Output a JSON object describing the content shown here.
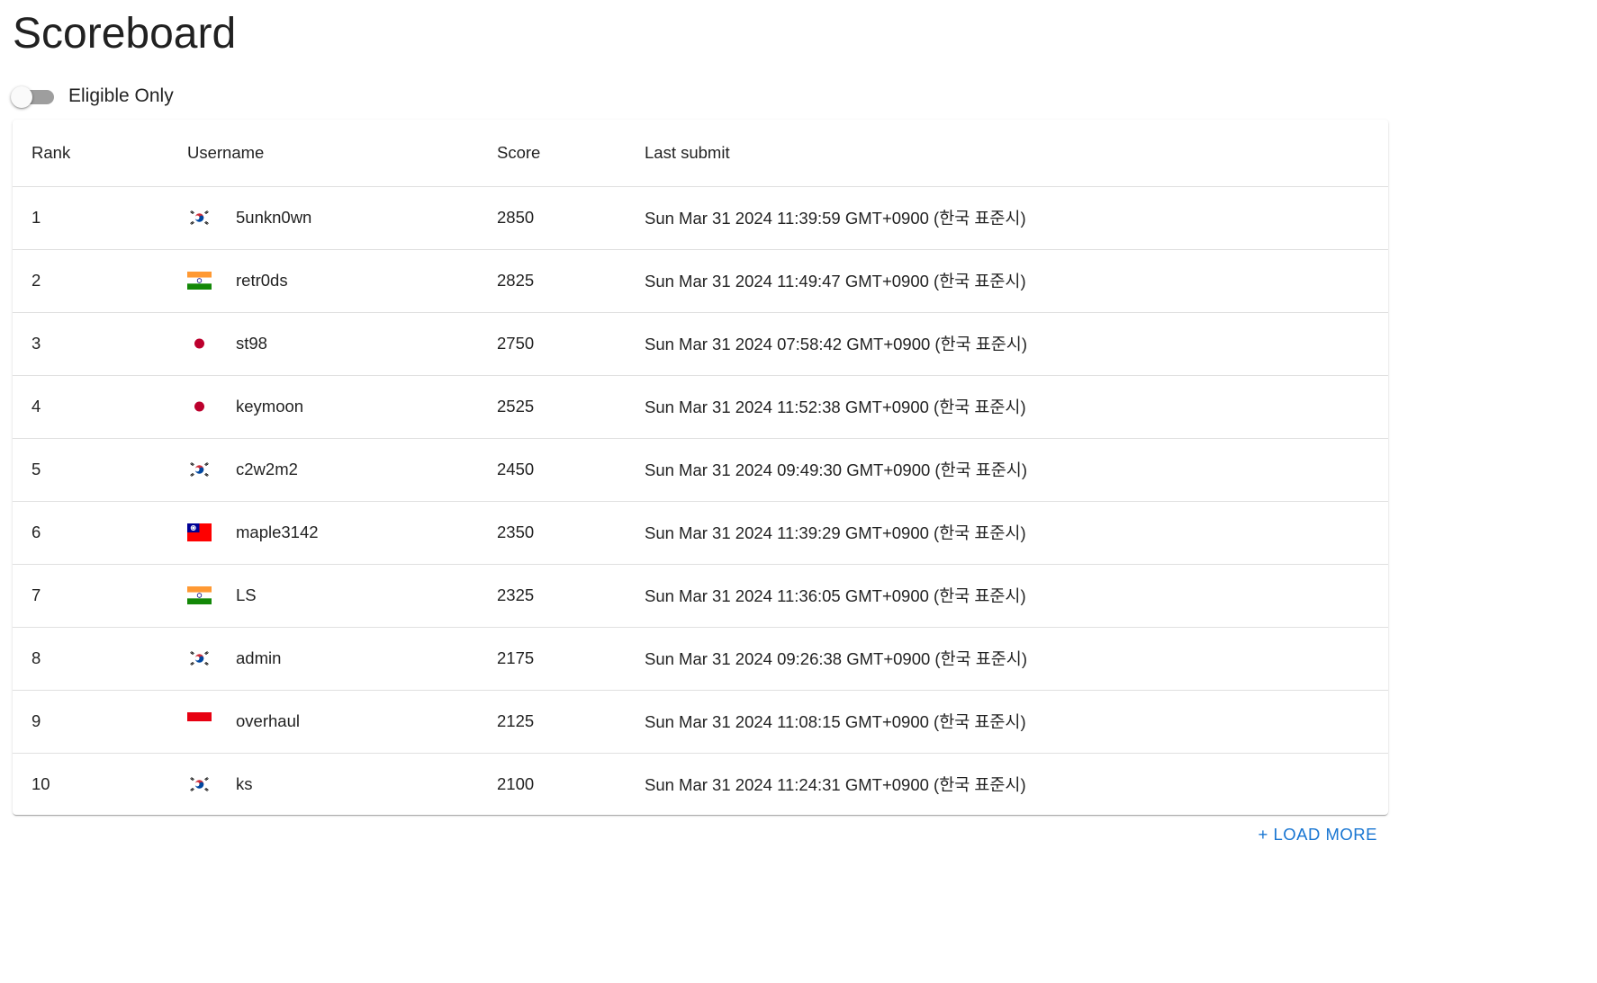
{
  "page": {
    "title": "Scoreboard"
  },
  "filter": {
    "eligible_only_label": "Eligible Only",
    "eligible_only_on": false
  },
  "table": {
    "headers": {
      "rank": "Rank",
      "username": "Username",
      "score": "Score",
      "last_submit": "Last submit"
    },
    "rows": [
      {
        "rank": "1",
        "flag": "kr-flag-icon",
        "username": "5unkn0wn",
        "score": "2850",
        "last_submit": "Sun Mar 31 2024 11:39:59 GMT+0900 (한국 표준시)"
      },
      {
        "rank": "2",
        "flag": "in-flag-icon",
        "username": "retr0ds",
        "score": "2825",
        "last_submit": "Sun Mar 31 2024 11:49:47 GMT+0900 (한국 표준시)"
      },
      {
        "rank": "3",
        "flag": "jp-flag-icon",
        "username": "st98",
        "score": "2750",
        "last_submit": "Sun Mar 31 2024 07:58:42 GMT+0900 (한국 표준시)"
      },
      {
        "rank": "4",
        "flag": "jp-flag-icon",
        "username": "keymoon",
        "score": "2525",
        "last_submit": "Sun Mar 31 2024 11:52:38 GMT+0900 (한국 표준시)"
      },
      {
        "rank": "5",
        "flag": "kr-flag-icon",
        "username": "c2w2m2",
        "score": "2450",
        "last_submit": "Sun Mar 31 2024 09:49:30 GMT+0900 (한국 표준시)"
      },
      {
        "rank": "6",
        "flag": "tw-flag-icon",
        "username": "maple3142",
        "score": "2350",
        "last_submit": "Sun Mar 31 2024 11:39:29 GMT+0900 (한국 표준시)"
      },
      {
        "rank": "7",
        "flag": "in-flag-icon",
        "username": "LS",
        "score": "2325",
        "last_submit": "Sun Mar 31 2024 11:36:05 GMT+0900 (한국 표준시)"
      },
      {
        "rank": "8",
        "flag": "kr-flag-icon",
        "username": "admin",
        "score": "2175",
        "last_submit": "Sun Mar 31 2024 09:26:38 GMT+0900 (한국 표준시)"
      },
      {
        "rank": "9",
        "flag": "id-flag-icon",
        "username": "overhaul",
        "score": "2125",
        "last_submit": "Sun Mar 31 2024 11:08:15 GMT+0900 (한국 표준시)"
      },
      {
        "rank": "10",
        "flag": "kr-flag-icon",
        "username": "ks",
        "score": "2100",
        "last_submit": "Sun Mar 31 2024 11:24:31 GMT+0900 (한국 표준시)"
      }
    ]
  },
  "load_more": {
    "label": "+ LOAD MORE"
  },
  "colors": {
    "accent": "#1976d2",
    "switch_track": "#9e9e9e",
    "divider": "#e0e0e0"
  }
}
